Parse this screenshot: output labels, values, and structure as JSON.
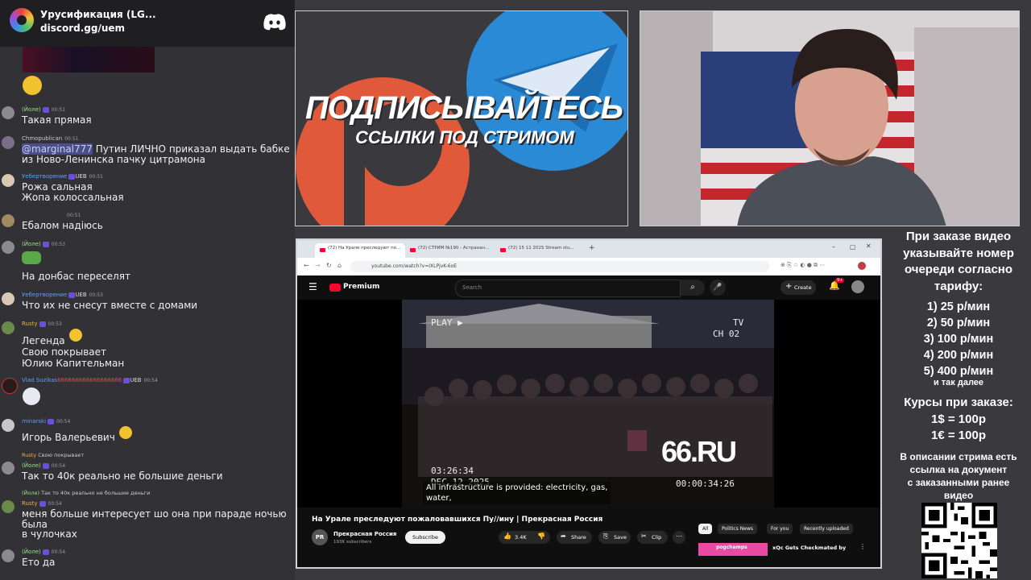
{
  "chat": {
    "server_name": "Урусификация (LG...",
    "invite": "discord.gg/uem",
    "messages": [
      {
        "user": "(Йоле)",
        "ts": "00:51",
        "text": "Такая прямая"
      },
      {
        "user": "Chmopublican",
        "ts": "00:51",
        "mention": "@marginal777",
        "text": " Путин ЛИЧНО приказал выдать бабке",
        "text2": "из Ново-Ленинска пачку цитрамона"
      },
      {
        "user": "Уебертворение",
        "tag": "UEB",
        "ts": "00:51",
        "text": "Рожа сальная",
        "text2": "Жопа колоссальная"
      },
      {
        "user": "",
        "ts": "00:51",
        "text": "Ебалом надіюсь"
      },
      {
        "user": "(Йоле)",
        "ts": "00:53",
        "text": "На донбас переселят"
      },
      {
        "user": "Уебертворение",
        "tag": "UEB",
        "ts": "00:53",
        "text": "Что их не снесут вместе с домами"
      },
      {
        "user": "Rusty",
        "ts": "00:53",
        "text": "Легенда",
        "text2": "Свою покрывает",
        "text3": "Юлию Капительман"
      },
      {
        "user": "Vlad Suzikas",
        "extra": "666666666666666666",
        "tag": "UEB",
        "ts": "00:54"
      },
      {
        "user": "minarski",
        "ts": "00:54",
        "text": "Игорь Валерьевич"
      },
      {
        "reply_user": "Rusty",
        "reply_text": "Свою покрывает",
        "user": "(Йоле)",
        "ts": "00:54",
        "text": "Так то 40к реально не большие деньги"
      },
      {
        "reply_user": "(Йоле)",
        "reply_text": "Так то 40к реально не большие деньги",
        "user": "Rusty",
        "ts": "00:54",
        "text": "меня больше интересует шо она при параде ночью",
        "text2": "была",
        "text3": "в чулочках"
      },
      {
        "user": "(Йоле)",
        "ts": "00:54",
        "text": "Ето да"
      }
    ]
  },
  "promo": {
    "title": "ПОДПИСЫВАЙТЕСЬ",
    "subtitle": "ССЫЛКИ ПОД СТРИМОМ"
  },
  "browser": {
    "tabs": [
      "(72) На Урале преследуют по...",
      "(72) СТРИМ №190 - Астрахан...",
      "(72) 15 11 2025 Stream stu..."
    ],
    "url": "youtube.com/watch?v=IXLPjvK-6oE",
    "yt_brand": "Premium",
    "search_placeholder": "Search",
    "create_label": "Create",
    "notif_count": "9+",
    "video": {
      "play_label": "PLAY ▶",
      "tv_label": "TV",
      "channel_label": "CH 02",
      "timecode": "03:26:34",
      "date_text": "DEC 12 2025",
      "counter": "00:00:34:26",
      "watermark": "66.RU",
      "subtitle1": "All infrastructure is provided: electricity, gas,",
      "subtitle2": "water,"
    },
    "video_title": "На Урале преследуют пожаловавшихся Пу//ину | Прекрасная Россия",
    "channel_name": "Прекрасная Россия",
    "channel_initials": "PR",
    "subscribers": "193K subscribers",
    "subscribe_label": "Subscribe",
    "likes": "3.4K",
    "share_label": "Share",
    "save_label": "Save",
    "clip_label": "Clip",
    "chips": [
      "All",
      "Politics News",
      "For you",
      "Recently uploaded"
    ],
    "rec_thumb_label": "pogchamps",
    "rec_title": "xQc Gets Checkmated by"
  },
  "info": {
    "lines1": [
      "При заказе видео",
      "указывайте номер",
      "очереди согласно",
      "тарифу:"
    ],
    "tariffs": [
      "1) 25 р/мин",
      "2) 50 р/мин",
      "3) 100 р/мин",
      "4) 200 р/мин",
      "5) 400 р/мин"
    ],
    "etc": "и так далее",
    "rates_title": "Курсы при заказе:",
    "rates": [
      "1$ = 100р",
      "1€ = 100р"
    ],
    "desc": [
      "В описании стрима есть",
      "ссылка на документ",
      "с заказанными ранее",
      "видео"
    ]
  },
  "colors": {
    "chat_bg": "#323236",
    "yt_red": "#ff0033",
    "telegram_blue": "#2a8ad6",
    "patreon_orange": "#e0593a"
  }
}
